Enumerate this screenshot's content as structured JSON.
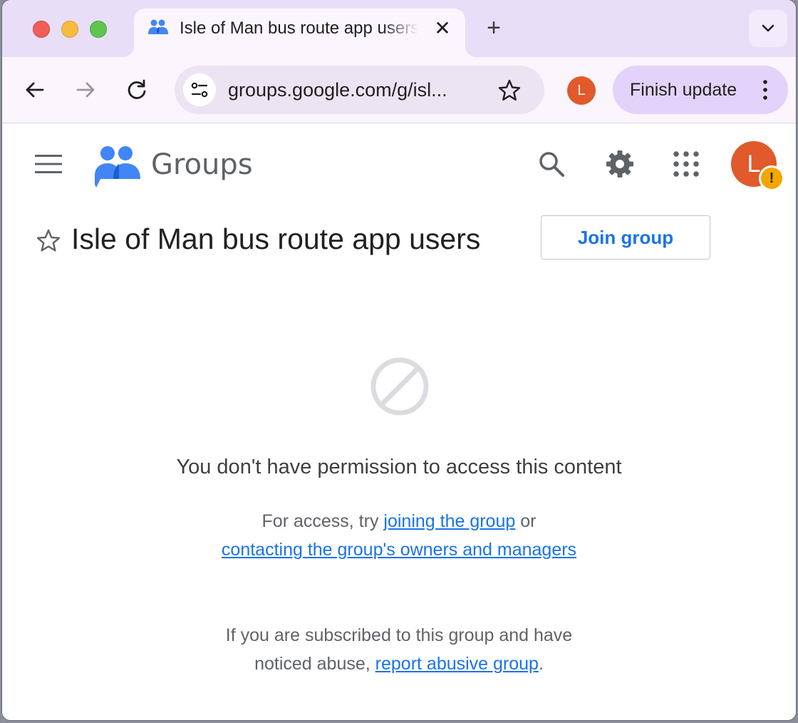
{
  "browser": {
    "tab_title": "Isle of Man bus route app users",
    "tab_close": "✕",
    "new_tab": "+",
    "url": "groups.google.com/g/isl...",
    "profile_initial": "L",
    "finish_update_label": "Finish update"
  },
  "app": {
    "brand": "Groups",
    "avatar_initial": "L",
    "alert_glyph": "!",
    "group_title": "Isle of Man bus route app users",
    "join_label": "Join group"
  },
  "message": {
    "heading": "You don't have permission to access this content",
    "access_prefix": "For access, try ",
    "access_link1": "joining the group",
    "access_mid": " or ",
    "access_link2": "contacting the group's owners and managers",
    "abuse_prefix": "If you are subscribed to this group and have noticed abuse, ",
    "abuse_link": "report abusive group",
    "abuse_suffix": "."
  },
  "colors": {
    "accent": "#1a73e8",
    "avatar": "#e05a2b",
    "tabstrip": "#e9def8",
    "update_chip": "#e3d3fa"
  }
}
